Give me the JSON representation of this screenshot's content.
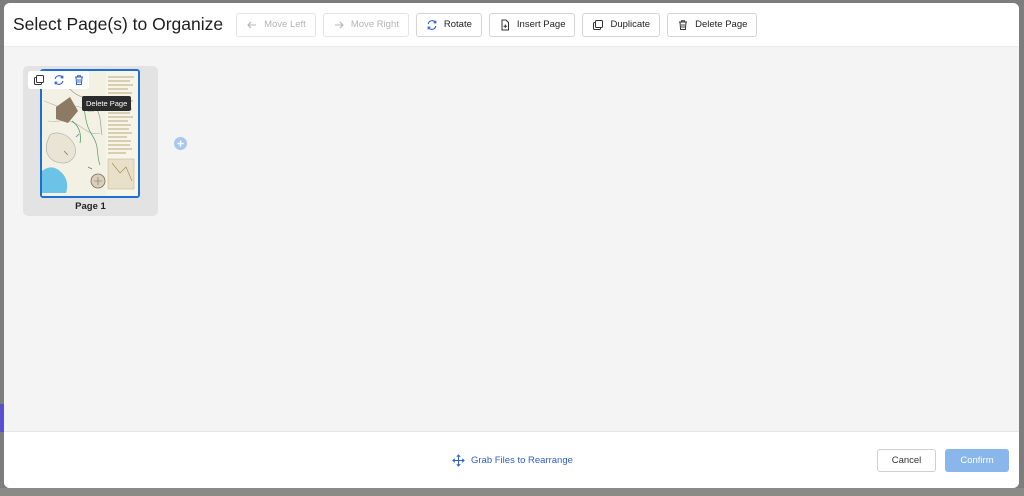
{
  "header": {
    "title": "Select Page(s) to Organize",
    "buttons": {
      "move_left": "Move Left",
      "move_right": "Move Right",
      "rotate": "Rotate",
      "insert_page": "Insert Page",
      "duplicate": "Duplicate",
      "delete_page": "Delete Page"
    }
  },
  "pages": [
    {
      "label": "Page 1",
      "tooltip": "Delete Page",
      "selected": true
    }
  ],
  "footer": {
    "grab_label": "Grab Files to Rearrange",
    "cancel_label": "Cancel",
    "confirm_label": "Confirm"
  },
  "colors": {
    "accent": "#1f6fd0",
    "confirm_bg": "#89b6eb",
    "link": "#2f5fc9",
    "add_page": "#a9c6ef"
  }
}
